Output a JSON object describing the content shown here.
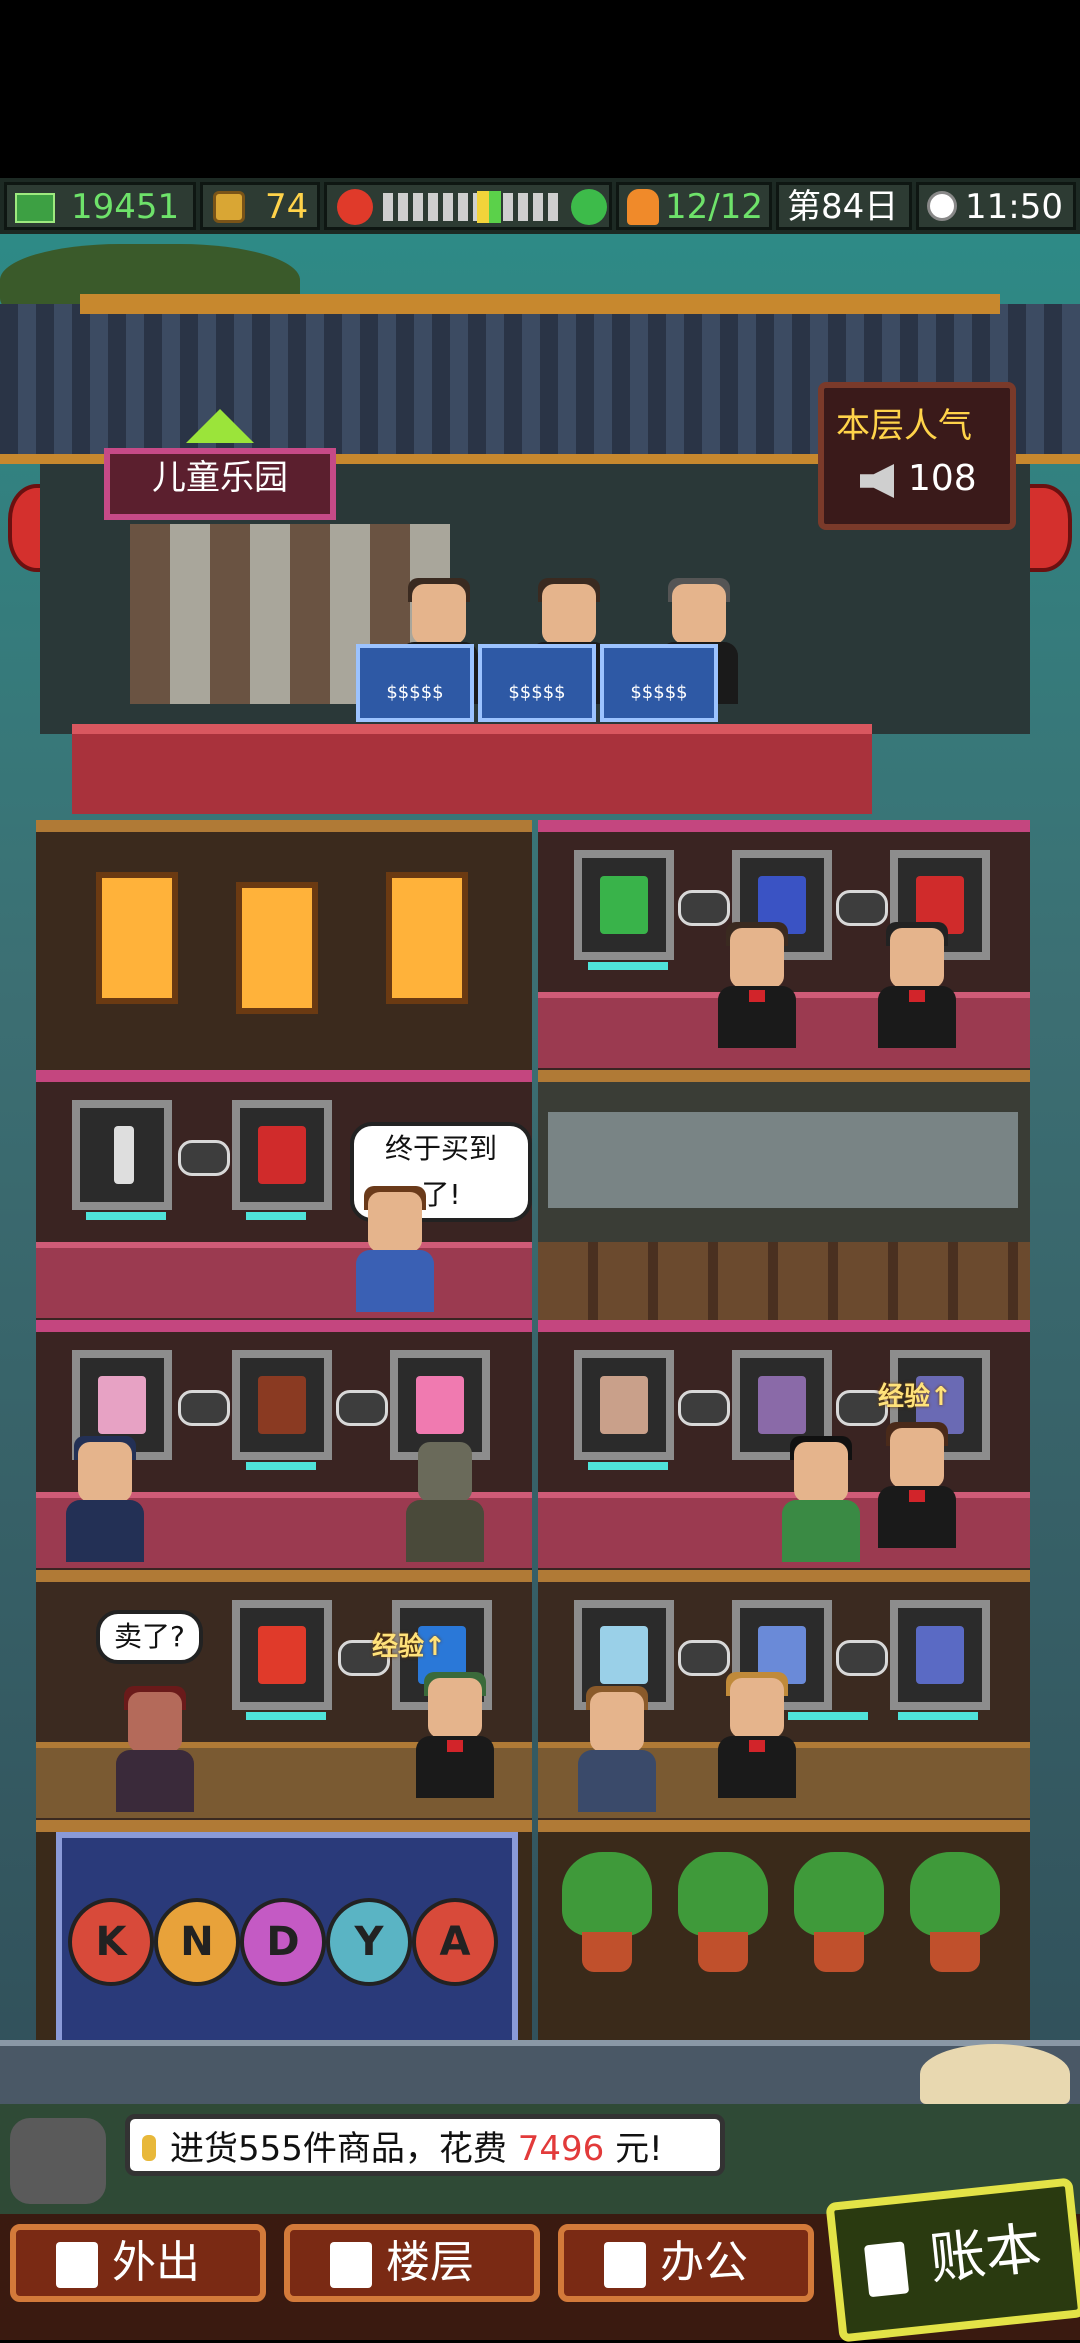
{
  "hud": {
    "money": "19451",
    "coins": "74",
    "mood_level": 0.55,
    "staff": "12/12",
    "day": "第84日",
    "time": "11:50"
  },
  "top_store": {
    "sign": "儿童乐园",
    "popularity_label": "本层人气",
    "popularity_value": "108",
    "register_label": "$$$$$"
  },
  "bubbles": {
    "bought": "终于买到了!",
    "sold": "卖了?"
  },
  "buff_label": "经验",
  "slot_letters": [
    "K",
    "N",
    "D",
    "Y",
    "A"
  ],
  "message": {
    "prefix": "进货555件商品，花费",
    "amount": "7496",
    "suffix": "元!"
  },
  "nav": {
    "go_out": "外出",
    "floors": "楼层",
    "office": "办公",
    "ledger": "账本"
  }
}
